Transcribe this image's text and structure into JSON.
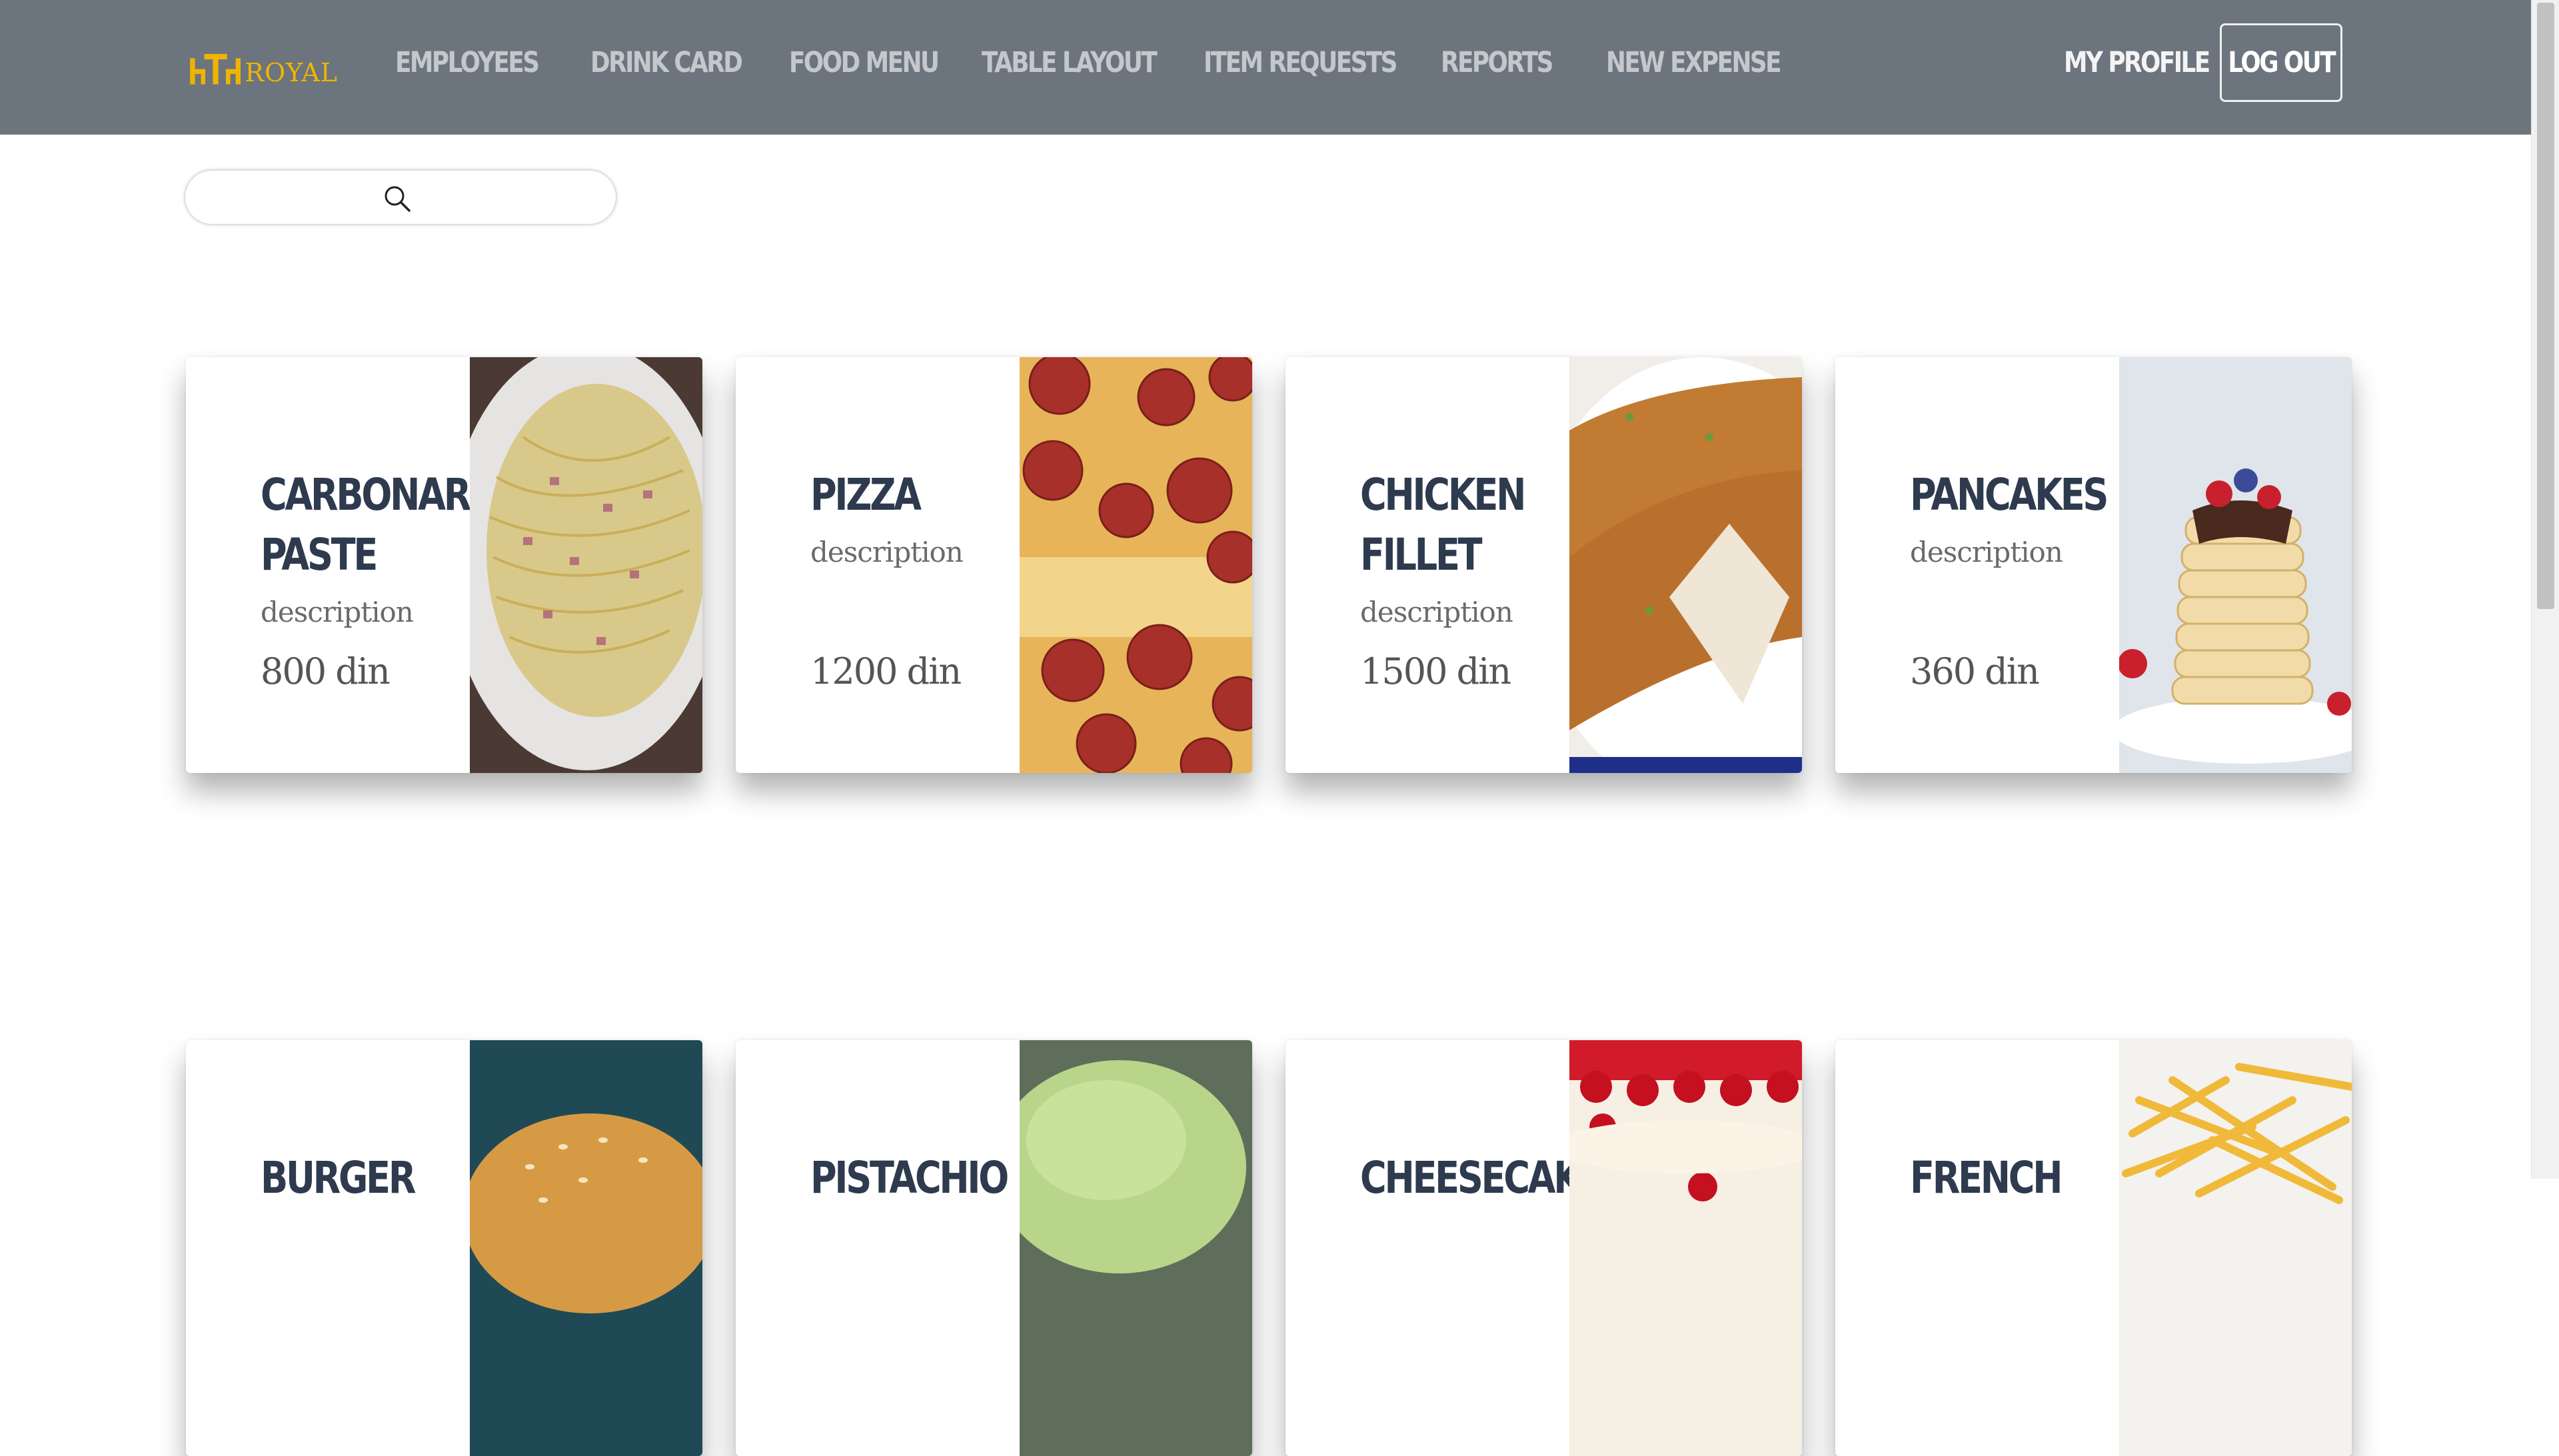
{
  "brand": {
    "name": "ROYAL"
  },
  "nav": {
    "items": [
      {
        "label": "EMPLOYEES"
      },
      {
        "label": "DRINK CARD"
      },
      {
        "label": "FOOD MENU"
      },
      {
        "label": "TABLE LAYOUT"
      },
      {
        "label": "ITEM REQUESTS"
      },
      {
        "label": "REPORTS"
      },
      {
        "label": "NEW EXPENSE"
      }
    ],
    "profile": "MY PROFILE",
    "logout": "LOG OUT"
  },
  "search": {
    "value": "",
    "placeholder": ""
  },
  "menu": {
    "items": [
      {
        "name": "CARBONARA PASTE",
        "description": "description",
        "price": "800 din",
        "image": "carbonara-pasta"
      },
      {
        "name": "PIZZA",
        "description": "description",
        "price": "1200 din",
        "image": "pepperoni-pizza"
      },
      {
        "name": "CHICKEN FILLET",
        "description": "description",
        "price": "1500 din",
        "image": "chicken-fillet"
      },
      {
        "name": "PANCAKES",
        "description": "description",
        "price": "360 din",
        "image": "pancakes"
      },
      {
        "name": "BURGER",
        "image": "burger"
      },
      {
        "name": "PISTACHIO",
        "image": "pistachio-ice-cream"
      },
      {
        "name": "CHEESECAKE",
        "image": "cheesecake"
      },
      {
        "name": "FRENCH",
        "image": "french-fries"
      }
    ]
  },
  "colors": {
    "navbar": "#6c757d",
    "brand": "#f0b400",
    "title": "#2e3a4e"
  }
}
